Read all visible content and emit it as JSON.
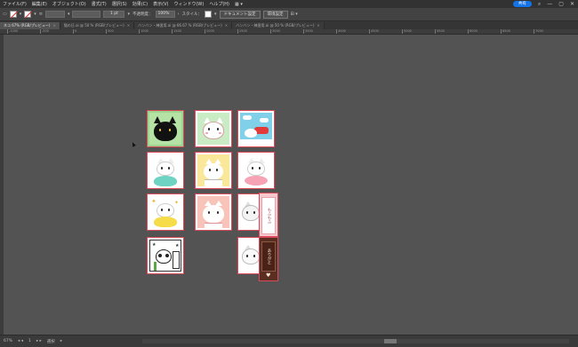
{
  "menubar": {
    "items": [
      "ファイル(F)",
      "編集(E)",
      "オブジェクト(O)",
      "書式(T)",
      "選択(S)",
      "効果(C)",
      "表示(V)",
      "ウィンドウ(W)",
      "ヘルプ(H)"
    ],
    "share_label": "共有"
  },
  "controlbar": {
    "stroke_weight": "1 pt",
    "opacity_label": "不透明度：",
    "opacity_value": "100%",
    "style_label": "スタイル：",
    "document_setup": "ドキュメント設定",
    "preferences": "環境設定"
  },
  "tabs": [
    {
      "label": "ネコ 67% (RGB/プレビュー)",
      "active": true
    },
    {
      "label": "猫の日.ai @ 50 % (RGB/プレビュー)",
      "active": false
    },
    {
      "label": "バンバン・練習用.ai @ 66.67 % (RGB/プレビュー)",
      "active": false
    },
    {
      "label": "バンバン・練習用.ai @ 50 % (RGB/プレビュー)",
      "active": false
    }
  ],
  "ruler": {
    "ticks": [
      "-1000",
      "-500",
      "0",
      "500",
      "1000",
      "1500",
      "2000",
      "2500",
      "3000",
      "3500",
      "4000",
      "4500",
      "5000",
      "5500",
      "6000",
      "6500",
      "7000"
    ]
  },
  "sidetags": {
    "tag_a": "もふもふ",
    "tag_b": "ありがと"
  },
  "statusbar": {
    "zoom": "67%",
    "page": "1",
    "tool": "選択"
  },
  "colors": {
    "accent": "#1473e6",
    "card_border": "#d94a5a",
    "canvas": "#535353"
  }
}
